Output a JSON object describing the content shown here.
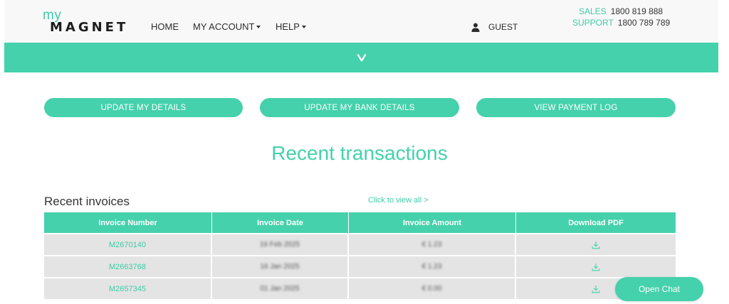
{
  "brand": {
    "my": "my",
    "name": "MAGNET"
  },
  "nav": {
    "home": "HOME",
    "my_account": "MY ACCOUNT",
    "help": "HELP"
  },
  "user": {
    "label": "GUEST",
    "icon": "user-icon"
  },
  "contact": {
    "sales_label": "SALES",
    "sales_number": "1800 819 888",
    "support_label": "SUPPORT",
    "support_number": "1800 789 789"
  },
  "banner": {
    "chevron": "V"
  },
  "actions": {
    "update_details": "UPDATE MY DETAILS",
    "update_bank": "UPDATE MY BANK DETAILS",
    "payment_log": "VIEW PAYMENT LOG"
  },
  "section_title": "Recent transactions",
  "invoices": {
    "heading": "Recent invoices",
    "view_all": "Click to view all >",
    "columns": [
      "Invoice Number",
      "Invoice Date",
      "Invoice Amount",
      "Download PDF"
    ],
    "rows": [
      {
        "number": "M2670140",
        "date": "16 Feb 2025",
        "amount": "€ 1.23"
      },
      {
        "number": "M2663768",
        "date": "16 Jan 2025",
        "amount": "€ 1.23"
      },
      {
        "number": "M2657345",
        "date": "01 Jan 2025",
        "amount": "€ 0.00"
      }
    ]
  },
  "chat": {
    "label": "Open Chat"
  },
  "colors": {
    "accent": "#45d1ac",
    "accent_text": "#3dcca7",
    "row_bg": "#e4e4e4"
  }
}
